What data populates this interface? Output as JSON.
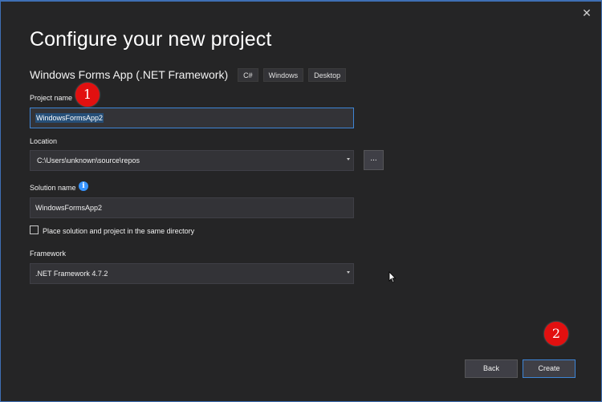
{
  "dialog": {
    "title": "Configure your new project",
    "close_glyph": "✕"
  },
  "template": {
    "name": "Windows Forms App (.NET Framework)",
    "tags": [
      "C#",
      "Windows",
      "Desktop"
    ]
  },
  "project_name": {
    "label": "Project name",
    "value": "WindowsFormsApp2"
  },
  "location": {
    "label": "Location",
    "value": "C:\\Users\\unknown\\source\\repos",
    "browse_label": "..."
  },
  "solution_name": {
    "label": "Solution name",
    "info_glyph": "i",
    "value": "WindowsFormsApp2"
  },
  "same_directory": {
    "label": "Place solution and project in the same directory",
    "checked": false
  },
  "framework": {
    "label": "Framework",
    "value": ".NET Framework 4.7.2"
  },
  "buttons": {
    "back": "Back",
    "create": "Create"
  },
  "annotations": {
    "step1": "1",
    "step2": "2",
    "color": "#e21010"
  },
  "colors": {
    "background": "#252526",
    "field": "#333337",
    "accent": "#3e85d6",
    "selection": "#264f78"
  }
}
